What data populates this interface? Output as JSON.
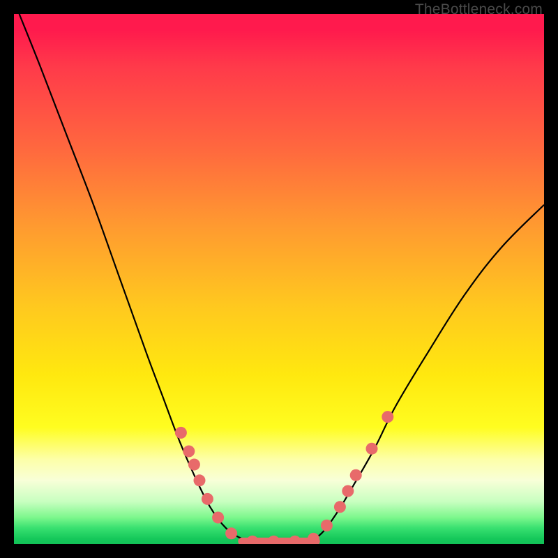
{
  "watermark": "TheBottleneck.com",
  "chart_data": {
    "type": "line",
    "title": "",
    "xlabel": "",
    "ylabel": "",
    "xlim": [
      0,
      100
    ],
    "ylim": [
      0,
      100
    ],
    "curve_left": [
      {
        "x": 1,
        "y": 100
      },
      {
        "x": 5,
        "y": 90
      },
      {
        "x": 10,
        "y": 77
      },
      {
        "x": 15,
        "y": 64
      },
      {
        "x": 20,
        "y": 50
      },
      {
        "x": 25,
        "y": 36
      },
      {
        "x": 28,
        "y": 28
      },
      {
        "x": 31,
        "y": 20
      },
      {
        "x": 34,
        "y": 13
      },
      {
        "x": 37,
        "y": 7
      },
      {
        "x": 40,
        "y": 3
      },
      {
        "x": 43,
        "y": 1
      },
      {
        "x": 46,
        "y": 0
      }
    ],
    "curve_right": [
      {
        "x": 55,
        "y": 0
      },
      {
        "x": 58,
        "y": 2
      },
      {
        "x": 61,
        "y": 6
      },
      {
        "x": 64,
        "y": 11
      },
      {
        "x": 68,
        "y": 18
      },
      {
        "x": 72,
        "y": 26
      },
      {
        "x": 78,
        "y": 36
      },
      {
        "x": 85,
        "y": 47
      },
      {
        "x": 92,
        "y": 56
      },
      {
        "x": 100,
        "y": 64
      }
    ],
    "flat_segment": {
      "x_start": 43,
      "x_end": 57,
      "y": 0.5
    },
    "markers": [
      {
        "x": 31.5,
        "y": 21
      },
      {
        "x": 33.0,
        "y": 17.5
      },
      {
        "x": 34.0,
        "y": 15
      },
      {
        "x": 35.0,
        "y": 12
      },
      {
        "x": 36.5,
        "y": 8.5
      },
      {
        "x": 38.5,
        "y": 5
      },
      {
        "x": 41.0,
        "y": 2
      },
      {
        "x": 45.0,
        "y": 0.5
      },
      {
        "x": 49.0,
        "y": 0.5
      },
      {
        "x": 53.0,
        "y": 0.5
      },
      {
        "x": 56.5,
        "y": 1
      },
      {
        "x": 59.0,
        "y": 3.5
      },
      {
        "x": 61.5,
        "y": 7
      },
      {
        "x": 63.0,
        "y": 10
      },
      {
        "x": 64.5,
        "y": 13
      },
      {
        "x": 67.5,
        "y": 18
      },
      {
        "x": 70.5,
        "y": 24
      }
    ],
    "colors": {
      "curve": "#000000",
      "marker_fill": "#e86a6a",
      "marker_stroke": "#d85050",
      "flat_stroke": "#e86a6a"
    }
  }
}
